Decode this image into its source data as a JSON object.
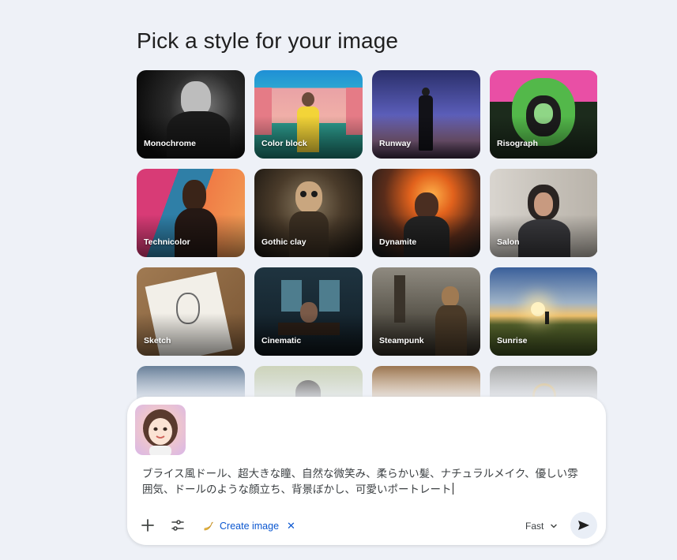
{
  "heading": "Pick a style for your image",
  "styles": [
    {
      "label": "Monochrome",
      "icon": "portrait-image"
    },
    {
      "label": "Color block",
      "icon": "portrait-image"
    },
    {
      "label": "Runway",
      "icon": "portrait-image"
    },
    {
      "label": "Risograph",
      "icon": "portrait-image"
    },
    {
      "label": "Technicolor",
      "icon": "portrait-image"
    },
    {
      "label": "Gothic clay",
      "icon": "portrait-image"
    },
    {
      "label": "Dynamite",
      "icon": "portrait-image"
    },
    {
      "label": "Salon",
      "icon": "portrait-image"
    },
    {
      "label": "Sketch",
      "icon": "portrait-image"
    },
    {
      "label": "Cinematic",
      "icon": "portrait-image"
    },
    {
      "label": "Steampunk",
      "icon": "portrait-image"
    },
    {
      "label": "Sunrise",
      "icon": "landscape-image"
    }
  ],
  "composer": {
    "prompt_text": "ブライス風ドール、超大きな瞳、自然な微笑み、柔らかい髪、ナチュラルメイク、優しい雰囲気、ドールのような顔立ち、背景ぼかし、可愛いポートレート",
    "tool_chip": {
      "label": "Create image",
      "icon": "banana-icon",
      "close": "✕"
    },
    "mode": "Fast",
    "accent": "#0b57d0"
  }
}
